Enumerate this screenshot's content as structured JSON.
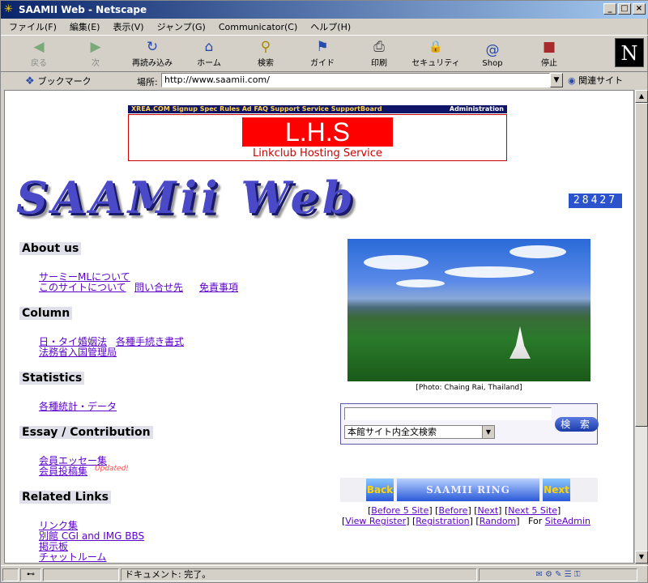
{
  "window": {
    "title": "SAAMII Web - Netscape",
    "controls": [
      "_",
      "□",
      "×"
    ]
  },
  "menu": [
    "ファイル(F)",
    "編集(E)",
    "表示(V)",
    "ジャンプ(G)",
    "Communicator(C)",
    "ヘルプ(H)"
  ],
  "toolbar": [
    {
      "label": "戻る",
      "icon": "back-arrow-icon",
      "glyph": "◀",
      "enabled": false
    },
    {
      "label": "次",
      "icon": "forward-arrow-icon",
      "glyph": "▶",
      "enabled": false
    },
    {
      "label": "再読み込み",
      "icon": "reload-icon",
      "glyph": "↻",
      "enabled": true
    },
    {
      "label": "ホーム",
      "icon": "home-icon",
      "glyph": "⌂",
      "enabled": true
    },
    {
      "label": "検索",
      "icon": "search-icon",
      "glyph": "⚲",
      "enabled": true
    },
    {
      "label": "ガイド",
      "icon": "guide-icon",
      "glyph": "⚑",
      "enabled": true
    },
    {
      "label": "印刷",
      "icon": "print-icon",
      "glyph": "⎙",
      "enabled": true
    },
    {
      "label": "セキュリティ",
      "icon": "lock-icon",
      "glyph": "🔒",
      "enabled": true
    },
    {
      "label": "Shop",
      "icon": "shop-icon",
      "glyph": "@",
      "enabled": true
    },
    {
      "label": "停止",
      "icon": "stop-icon",
      "glyph": "■",
      "enabled": true
    }
  ],
  "brand_logo": "N",
  "location": {
    "bookmarks_label": "ブックマーク",
    "label": "場所:",
    "url": "http://www.saamii.com/",
    "related_label": "関連サイト"
  },
  "page": {
    "ad": {
      "bar_links": "XREA.COM  Signup  Spec  Rules  Ad  FAQ  Support  Service  SupportBoard",
      "admin": "Administration",
      "title": "L.H.S",
      "subtitle": "Linkclub Hosting Service"
    },
    "logo_text": "SAAMii Web",
    "counter": "28427",
    "sections": [
      {
        "title": "About us",
        "links": [
          "サーミーMLについて",
          "このサイトについて",
          "問い合せ先",
          "免責事項"
        ]
      },
      {
        "title": "Column",
        "links": [
          "日・タイ婚姻法",
          "各種手続き書式",
          "法務省入国管理局"
        ]
      },
      {
        "title": "Statistics",
        "links": [
          "各種統計・データ"
        ]
      },
      {
        "title": "Essay / Contribution",
        "links": [
          "会員エッセー集",
          "会員投稿集"
        ],
        "badge": "Updated!"
      },
      {
        "title": "Related Links",
        "links": [
          "リンク集",
          "別館 CGI and IMG BBS",
          "掲示板",
          "チャットルーム"
        ]
      }
    ],
    "photo_caption": "[Photo: Chaing Rai, Thailand]",
    "search": {
      "query": "",
      "scope": "本館サイト内全文検索",
      "button": "検 索"
    },
    "ring": {
      "back": "Back",
      "title": "SAAMII RING",
      "next": "Next",
      "links_row1": [
        "Before 5 Site",
        "Before",
        "Next",
        "Next 5 Site"
      ],
      "links_row2": [
        "View Register",
        "Registration",
        "Random"
      ],
      "for_label": "For",
      "admin_link": "SiteAdmin"
    }
  },
  "status": {
    "text": "ドキュメント: 完了。"
  },
  "colors": {
    "titlebar": "#0a246a",
    "link": "#5a00cc",
    "logo": "#4a4ac8",
    "counter_bg": "#2b54cc",
    "ad_red": "#ff0000"
  }
}
